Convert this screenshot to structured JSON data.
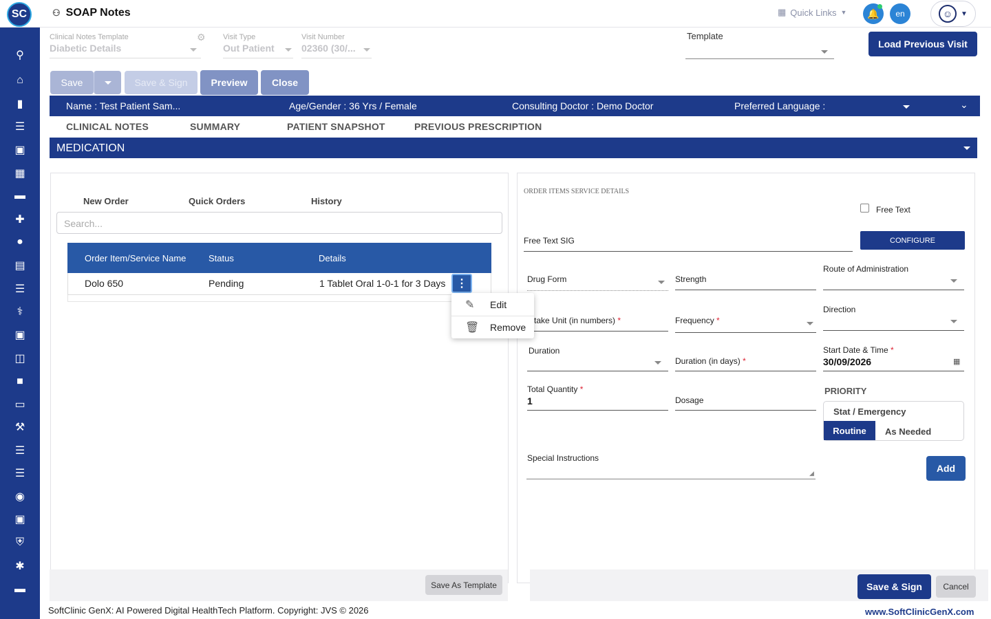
{
  "app": {
    "logo_text": "SC",
    "title": "SOAP Notes"
  },
  "topbar": {
    "quick_links": "Quick Links",
    "language": "en"
  },
  "sidebar": {
    "icons": [
      "search-icon",
      "home-icon",
      "chart-icon",
      "menu-icon",
      "clipboard-icon",
      "calendar-icon",
      "bed-icon",
      "medical-plus-icon",
      "person-icon",
      "document-icon",
      "list-icon",
      "pharmacy-icon",
      "medicine-icon",
      "book-icon",
      "building-icon",
      "devices-icon",
      "wrench-icon",
      "menu-icon",
      "menu-icon",
      "blood-drop-icon",
      "add-box-icon",
      "shield-icon",
      "network-icon",
      "folder-icon"
    ]
  },
  "form": {
    "clinical_template_label": "Clinical Notes Template",
    "clinical_template_value": "Diabetic Details",
    "visit_type_label": "Visit Type",
    "visit_type_value": "Out Patient",
    "visit_number_label": "Visit Number",
    "visit_number_value": "02360 (30/...",
    "template_label": "Template",
    "load_previous": "Load Previous Visit"
  },
  "actions": {
    "save": "Save",
    "save_sign": "Save & Sign",
    "preview": "Preview",
    "close": "Close"
  },
  "patient": {
    "name": "Name :  Test Patient Sam...",
    "age_gender": "Age/Gender :  36 Yrs / Female",
    "doctor": "Consulting Doctor :  Demo Doctor",
    "language": "Preferred Language :"
  },
  "tabs": [
    "CLINICAL NOTES",
    "SUMMARY",
    "PATIENT SNAPSHOT",
    "PREVIOUS PRESCRIPTION"
  ],
  "section_title": "MEDICATION",
  "order_tabs": [
    "New Order",
    "Quick Orders",
    "History"
  ],
  "search_placeholder": "Search...",
  "table": {
    "headers": [
      "Order Item/Service Name",
      "Status",
      "Details"
    ],
    "rows": [
      {
        "name": "Dolo 650",
        "status": "Pending",
        "details": "1 Tablet Oral 1-0-1 for 3 Days"
      }
    ]
  },
  "context_menu": {
    "edit": "Edit",
    "remove": "Remove"
  },
  "save_as_template": "Save As Template",
  "order_details": {
    "heading": "ORDER ITEMS SERVICE DETAILS",
    "free_text": "Free Text",
    "free_text_sig": "Free Text SIG",
    "configure": "CONFIGURE",
    "drug_form": "Drug Form",
    "strength": "Strength",
    "route": "Route of Administration",
    "intake_unit": "Intake Unit (in numbers)",
    "frequency": "Frequency",
    "direction": "Direction",
    "duration": "Duration",
    "duration_days": "Duration (in days)",
    "start_date_label": "Start Date & Time",
    "start_date_value": "30/09/2026",
    "total_quantity_label": "Total Quantity",
    "total_quantity_value": "1",
    "dosage": "Dosage",
    "priority_label": "PRIORITY",
    "priority_options": [
      "Stat / Emergency",
      "Routine",
      "As Needed"
    ],
    "special_instructions": "Special Instructions",
    "add": "Add"
  },
  "footer_actions": {
    "save_sign": "Save & Sign",
    "cancel": "Cancel"
  },
  "footer": {
    "copyright": "SoftClinic GenX: AI Powered Digital HealthTech Platform. Copyright: JVS © 2026",
    "website": "www.SoftClinicGenX.com"
  },
  "colors": {
    "primary": "#1d3a8a",
    "table_header": "#2859a6",
    "accent": "#2b84d6"
  }
}
